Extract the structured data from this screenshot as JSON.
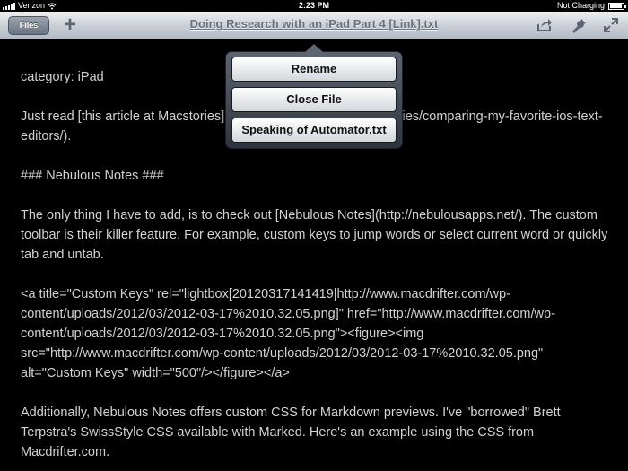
{
  "status_bar": {
    "carrier": "Verizon",
    "time": "2:23 PM",
    "charging": "Not Charging"
  },
  "toolbar": {
    "files_label": "Files",
    "add_label": "+",
    "title": "Doing Research with an iPad Part 4 [Link].txt",
    "icons": [
      "share-icon",
      "wrench-icon",
      "expand-icon"
    ]
  },
  "popover": {
    "items": [
      {
        "label": "Rename"
      },
      {
        "label": "Close File"
      },
      {
        "label": "Speaking of Automator.txt"
      }
    ]
  },
  "document": {
    "paragraphs": [
      "category: iPad",
      "Just read [this article at Macstories](http://www.macstories.net/stories/comparing-my-favorite-ios-text-editors/).",
      "### Nebulous Notes ###",
      "The only thing I have to add, is to check out [Nebulous Notes](http://nebulousapps.net/). The custom toolbar is their killer feature. For example, custom keys to jump words or select current word or quickly tab and untab.",
      "<a title=\"Custom Keys\" rel=\"lightbox[20120317141419|http://www.macdrifter.com/wp-content/uploads/2012/03/2012-03-17%2010.32.05.png]\" href=\"http://www.macdrifter.com/wp-content/uploads/2012/03/2012-03-17%2010.32.05.png\"><figure><img src=\"http://www.macdrifter.com/wp-content/uploads/2012/03/2012-03-17%2010.32.05.png\" alt=\"Custom Keys\" width=\"500\"/></figure></a>",
      "Additionally, Nebulous Notes offers custom CSS for Markdown previews. I've \"borrowed\" Brett Terpstra's SwissStyle CSS available with Marked. Here's an example using the CSS from Macdrifter.com."
    ]
  },
  "colors": {
    "background": "#000000",
    "text": "#d2d2d2",
    "toolbar_title": "#6a717b"
  }
}
